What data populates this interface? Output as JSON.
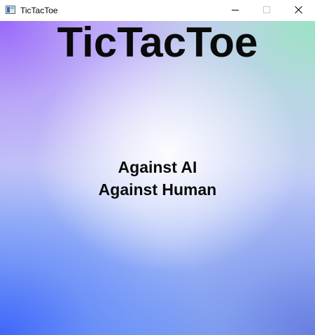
{
  "window": {
    "title": "TicTacToe",
    "icon": "app-window-icon",
    "controls": {
      "minimize_icon": "minimize-icon",
      "maximize_icon": "maximize-icon",
      "close_icon": "close-icon"
    }
  },
  "main": {
    "title": "TicTacToe",
    "menu": [
      {
        "label": "Against AI"
      },
      {
        "label": "Against Human"
      }
    ]
  },
  "colors": {
    "top_left": "#9d6cfb",
    "top_right": "#a8e6c8",
    "bottom_left": "#3f6df8",
    "bottom_right": "#6f86dc",
    "center": "#eef4fb",
    "text": "#0a0a0a"
  }
}
